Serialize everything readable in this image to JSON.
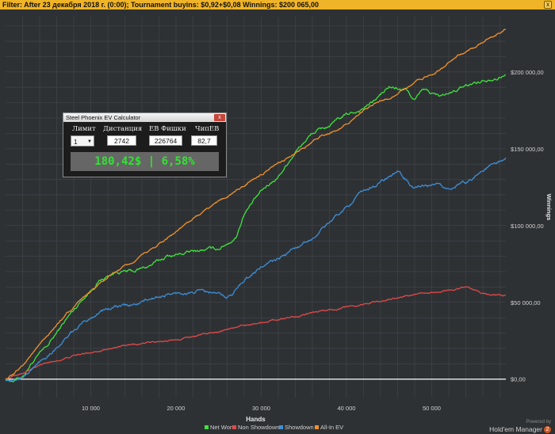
{
  "filter_bar": {
    "text": "Filter: After 23 декабря 2018 г. (0:00); Tournament buyins: $0,92+$0,08 Winnings: $200 065,00",
    "close_label": "x"
  },
  "calculator": {
    "title": "Steel Phoenix EV Calculator",
    "close_label": "x",
    "headers": [
      "Лимит",
      "Дистанция",
      "ЕВ Фишки",
      "ЧипЕВ"
    ],
    "limit_value": "1",
    "distance": "2742",
    "ev_chips": "226764",
    "chip_ev": "82,7",
    "result": "180,42$ | 6,58%"
  },
  "powered_by": {
    "line1": "Powered by",
    "line2": "Hold'em Manager",
    "badge": "2"
  },
  "colors": {
    "background": "#2e3134",
    "grid": "#43474b",
    "net_won": "#3ee23e",
    "non_showdown": "#e04a4a",
    "showdown": "#3d8fd8",
    "all_in_ev": "#f0922f",
    "zero_line": "#ffffff"
  },
  "chart_data": {
    "type": "line",
    "xlabel": "Hands",
    "ylabel": "Winnings",
    "x_ticks": [
      10000,
      20000,
      30000,
      40000,
      50000
    ],
    "x_tick_labels": [
      "10 000",
      "20 000",
      "30 000",
      "40 000",
      "50 000"
    ],
    "y_ticks": [
      0,
      50000,
      100000,
      150000,
      200000
    ],
    "y_tick_labels": [
      "$0,00",
      "$50 000,00",
      "$100 000,00",
      "$150 000,00",
      "$200 000,00"
    ],
    "xlim": [
      0,
      58700
    ],
    "ylim": [
      -12000,
      236000
    ],
    "legend_position": "bottom",
    "series": [
      {
        "name": "Net Won",
        "color_key": "net_won",
        "noise": 1400,
        "points": [
          [
            0,
            0
          ],
          [
            1000,
            -800
          ],
          [
            2000,
            2000
          ],
          [
            3000,
            10000
          ],
          [
            5000,
            22000
          ],
          [
            7000,
            38000
          ],
          [
            9000,
            52000
          ],
          [
            11000,
            64000
          ],
          [
            13000,
            70000
          ],
          [
            15000,
            70000
          ],
          [
            17000,
            74000
          ],
          [
            19000,
            80000
          ],
          [
            21000,
            82000
          ],
          [
            23000,
            84000
          ],
          [
            25000,
            85000
          ],
          [
            27000,
            92000
          ],
          [
            28000,
            108000
          ],
          [
            30000,
            122000
          ],
          [
            32000,
            132000
          ],
          [
            34000,
            148000
          ],
          [
            36000,
            160000
          ],
          [
            38000,
            165000
          ],
          [
            40000,
            172000
          ],
          [
            41500,
            175000
          ],
          [
            43000,
            180000
          ],
          [
            45000,
            190000
          ],
          [
            47000,
            188000
          ],
          [
            48000,
            182000
          ],
          [
            49000,
            188000
          ],
          [
            51000,
            184000
          ],
          [
            53000,
            188000
          ],
          [
            55000,
            193000
          ],
          [
            57000,
            196000
          ],
          [
            58700,
            198000
          ]
        ]
      },
      {
        "name": "Non Showdown",
        "color_key": "non_showdown",
        "noise": 700,
        "points": [
          [
            0,
            0
          ],
          [
            2000,
            4000
          ],
          [
            4000,
            9000
          ],
          [
            8000,
            15000
          ],
          [
            12000,
            20000
          ],
          [
            16000,
            23000
          ],
          [
            20000,
            26000
          ],
          [
            24000,
            30000
          ],
          [
            28000,
            35000
          ],
          [
            32000,
            39000
          ],
          [
            36000,
            43000
          ],
          [
            40000,
            47000
          ],
          [
            44000,
            51000
          ],
          [
            48000,
            55000
          ],
          [
            50000,
            56000
          ],
          [
            52000,
            58000
          ],
          [
            54000,
            60000
          ],
          [
            56000,
            56000
          ],
          [
            58700,
            54000
          ]
        ]
      },
      {
        "name": "Showdown",
        "color_key": "showdown",
        "noise": 1400,
        "points": [
          [
            0,
            0
          ],
          [
            1000,
            -800
          ],
          [
            2000,
            1000
          ],
          [
            3000,
            6000
          ],
          [
            5000,
            16000
          ],
          [
            7000,
            26000
          ],
          [
            9000,
            36000
          ],
          [
            11000,
            44000
          ],
          [
            13000,
            47000
          ],
          [
            15000,
            48000
          ],
          [
            17000,
            52000
          ],
          [
            19000,
            55000
          ],
          [
            21000,
            56000
          ],
          [
            23000,
            57000
          ],
          [
            25000,
            55000
          ],
          [
            26500,
            54000
          ],
          [
            28000,
            65000
          ],
          [
            30000,
            73000
          ],
          [
            32000,
            78000
          ],
          [
            34000,
            85000
          ],
          [
            36000,
            92000
          ],
          [
            38000,
            102000
          ],
          [
            40000,
            112000
          ],
          [
            42000,
            122000
          ],
          [
            44000,
            128000
          ],
          [
            46000,
            135000
          ],
          [
            47000,
            130000
          ],
          [
            48000,
            124000
          ],
          [
            50000,
            126000
          ],
          [
            52000,
            124000
          ],
          [
            54000,
            128000
          ],
          [
            56000,
            136000
          ],
          [
            58700,
            144000
          ]
        ]
      },
      {
        "name": "All-In EV",
        "color_key": "all_in_ev",
        "noise": 900,
        "points": [
          [
            0,
            0
          ],
          [
            1000,
            3000
          ],
          [
            2000,
            9000
          ],
          [
            3000,
            16000
          ],
          [
            5000,
            28000
          ],
          [
            7000,
            42000
          ],
          [
            9000,
            52000
          ],
          [
            11000,
            62000
          ],
          [
            13000,
            70000
          ],
          [
            15000,
            76000
          ],
          [
            17000,
            84000
          ],
          [
            19000,
            92000
          ],
          [
            21000,
            100000
          ],
          [
            23000,
            108000
          ],
          [
            25000,
            116000
          ],
          [
            27000,
            122000
          ],
          [
            29000,
            130000
          ],
          [
            31000,
            136000
          ],
          [
            33000,
            144000
          ],
          [
            35000,
            150000
          ],
          [
            37000,
            158000
          ],
          [
            39000,
            163000
          ],
          [
            41000,
            170000
          ],
          [
            43000,
            178000
          ],
          [
            45000,
            183000
          ],
          [
            47000,
            190000
          ],
          [
            49000,
            196000
          ],
          [
            51000,
            202000
          ],
          [
            53000,
            210000
          ],
          [
            55000,
            216000
          ],
          [
            57000,
            222000
          ],
          [
            58700,
            228000
          ]
        ]
      }
    ]
  }
}
